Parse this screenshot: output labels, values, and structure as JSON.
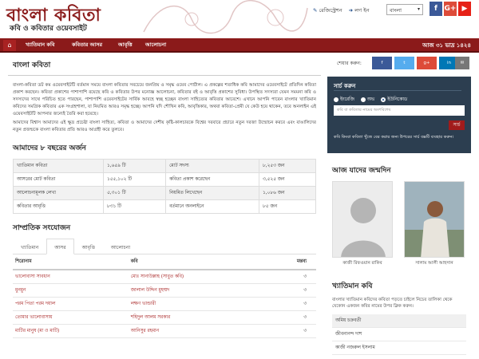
{
  "header": {
    "logo_title": "বাংলা কবিতা",
    "logo_subtitle": "কবি ও কবিতার ওয়েবসাইট",
    "link_register": "রেজিস্ট্রেশন",
    "link_login": "লগ ইন",
    "language_selected": "বাংলা"
  },
  "nav": {
    "items": [
      "খ্যাতিমান কবি",
      "কবিতার আসর",
      "আবৃত্তি",
      "আলোচনা"
    ],
    "date": "আজ ৩১ ভাদ্র ১৪২৪"
  },
  "main": {
    "section_title": "বাংলা কবিতা",
    "intro": [
      "বাংলা-কবিতা ডট কম ওয়েবসাইটটি বর্তমান সময়ে বাংলা কবিতার সবচেয়ে জনপ্রিয় ও সমৃদ্ধ ওয়েব পোর্টাল। এ প্রকল্পের শতাধিক কবি আমাদের ওয়েবসাইটে প্রতিদিন কবিতা প্রকাশ করছেন। কবিতা প্রকাশের পাশাপাশি রয়েছে কবি ও কবিতার উপর মনোজ্ঞ আলোচনা, কবিতার বই ও আবৃত্তি প্রকাশের সুবিধা। উপস্থিত সদস্যরা যেমন সমমনা কবি ও সদস্যদের সাথে পরিচিত হতে পারছেন, পাশাপাশি ওয়েবসাইটের সার্বিক আবহে স্বচ্ছ হচ্ছেন বাংলা সাহিত্যের কবিতার আবেশে। এখানে আপনি পাবেন বাংলার খ্যাতিমান কবিদের সমগ্রিক কবিতার এক সংগ্রহশালা, যা নিয়মিত আরও সমৃদ্ধ হচ্ছে। আপনি যদি শৌখিন কবি, আবৃত্তিকার, অথবা কবিতা-প্রেমী যে কেউ হয়ে থাকেন, তবে অনলাইন এই ওয়েবসাইটটি আপনার জন্যেই তৈরি করা হয়েছে।",
      "আমাদের বিশ্বাস আমাদের এই ক্ষুদ্র প্রচেষ্টা বাংলা সাহিত্য, কবিতা ও আমাদের দেশীয় কৃষ্টি-কালচারকে বিশ্বের দরবারে প্রচারে নতুন দরজা উন্মোচন করবে এবং বাঙালিদের নতুন প্রজন্মকে বাংলা কবিতার প্রতি আরও আগ্রহী করে তুলবে।"
    ],
    "stats_title": "আমাদের ৮ বছরের অর্জন",
    "stats": [
      [
        "খ্যাতিমান কবিতা",
        "১,৬৫৯ টি",
        "মোট সদস্য",
        "৮,২৫৩ জন"
      ],
      [
        "আসরের মোট কবিতা",
        "১৫৫,১০২ টি",
        "কবিতা প্রকাশ করেছেন",
        "৩,৫২৫ জন"
      ],
      [
        "আলোচনামূলক লেখা",
        "৫,৩০১ টি",
        "নিয়মিত লিখেছেন",
        "১,০৮৬ জন"
      ],
      [
        "কবিতার আবৃত্তি",
        "৮৩১ টি",
        "বর্তমানে অনলাইনে",
        "৮৫ জন"
      ]
    ],
    "recent_title": "সাম্প্রতিক সংযোজন",
    "tabs": [
      "খ্যাতিমান",
      "আসর",
      "আবৃত্তি",
      "আলোচনা"
    ],
    "table_headers": [
      "শিরোনাম",
      "কবি",
      "মন্তব্য"
    ],
    "rows": [
      [
        "ভালোবাসা সাবধান",
        "মোঃ সানাউল্লাহ (সাবুত কবি)",
        "৩"
      ],
      [
        "মুনমুন",
        "জালাল উদ্দিন মুহম্মদ",
        "৩"
      ],
      [
        "পরম পিতা পরম দয়াল",
        "লক্ষণ ভান্ডারী",
        "৩"
      ],
      [
        "তোমার ভালোবাসায়",
        "শহিদুল আলম সরকার",
        "৩"
      ],
      [
        "মাটির মানুষ (মা ও মাটি)",
        "আনিসুর রহমান",
        "৩"
      ]
    ]
  },
  "sidebar": {
    "share_label": "শেয়ার করুন:",
    "share_buttons": [
      "f",
      "t",
      "g+",
      "in",
      "✉"
    ],
    "search_title": "সার্চ করুন",
    "radio_options": [
      "ইংরেজি",
      "অভ",
      "ইউনিকোড"
    ],
    "search_placeholder": "কবি বা কবিতার নামের অংশবিশেষ",
    "search_button": "সার্চ",
    "search_note": "কবি কিংবা কবিতা খুঁজে বের করার জন্য উপরের সার্চ বক্সটি ব্যবহার করুন।",
    "birthday_title": "আজ যাদের জন্মদিন",
    "birthday_names": [
      "কাজী রিফওয়ান রাকিব",
      "সালাম আলী আহসান"
    ],
    "famous_title": "খ্যাতিমান কবি",
    "famous_desc": "বাংলার খ্যাতিমান কবিদের কবিতা পড়তে চাইলে নিচের তালিকা থেকে যেকোন একজন কবির নামের উপর ক্লিক করুন।",
    "famous_list": [
      "অমিয় চক্রবর্তী",
      "জীবনানন্দ দাশ",
      "কাজী নজরুল ইসলাম"
    ]
  }
}
